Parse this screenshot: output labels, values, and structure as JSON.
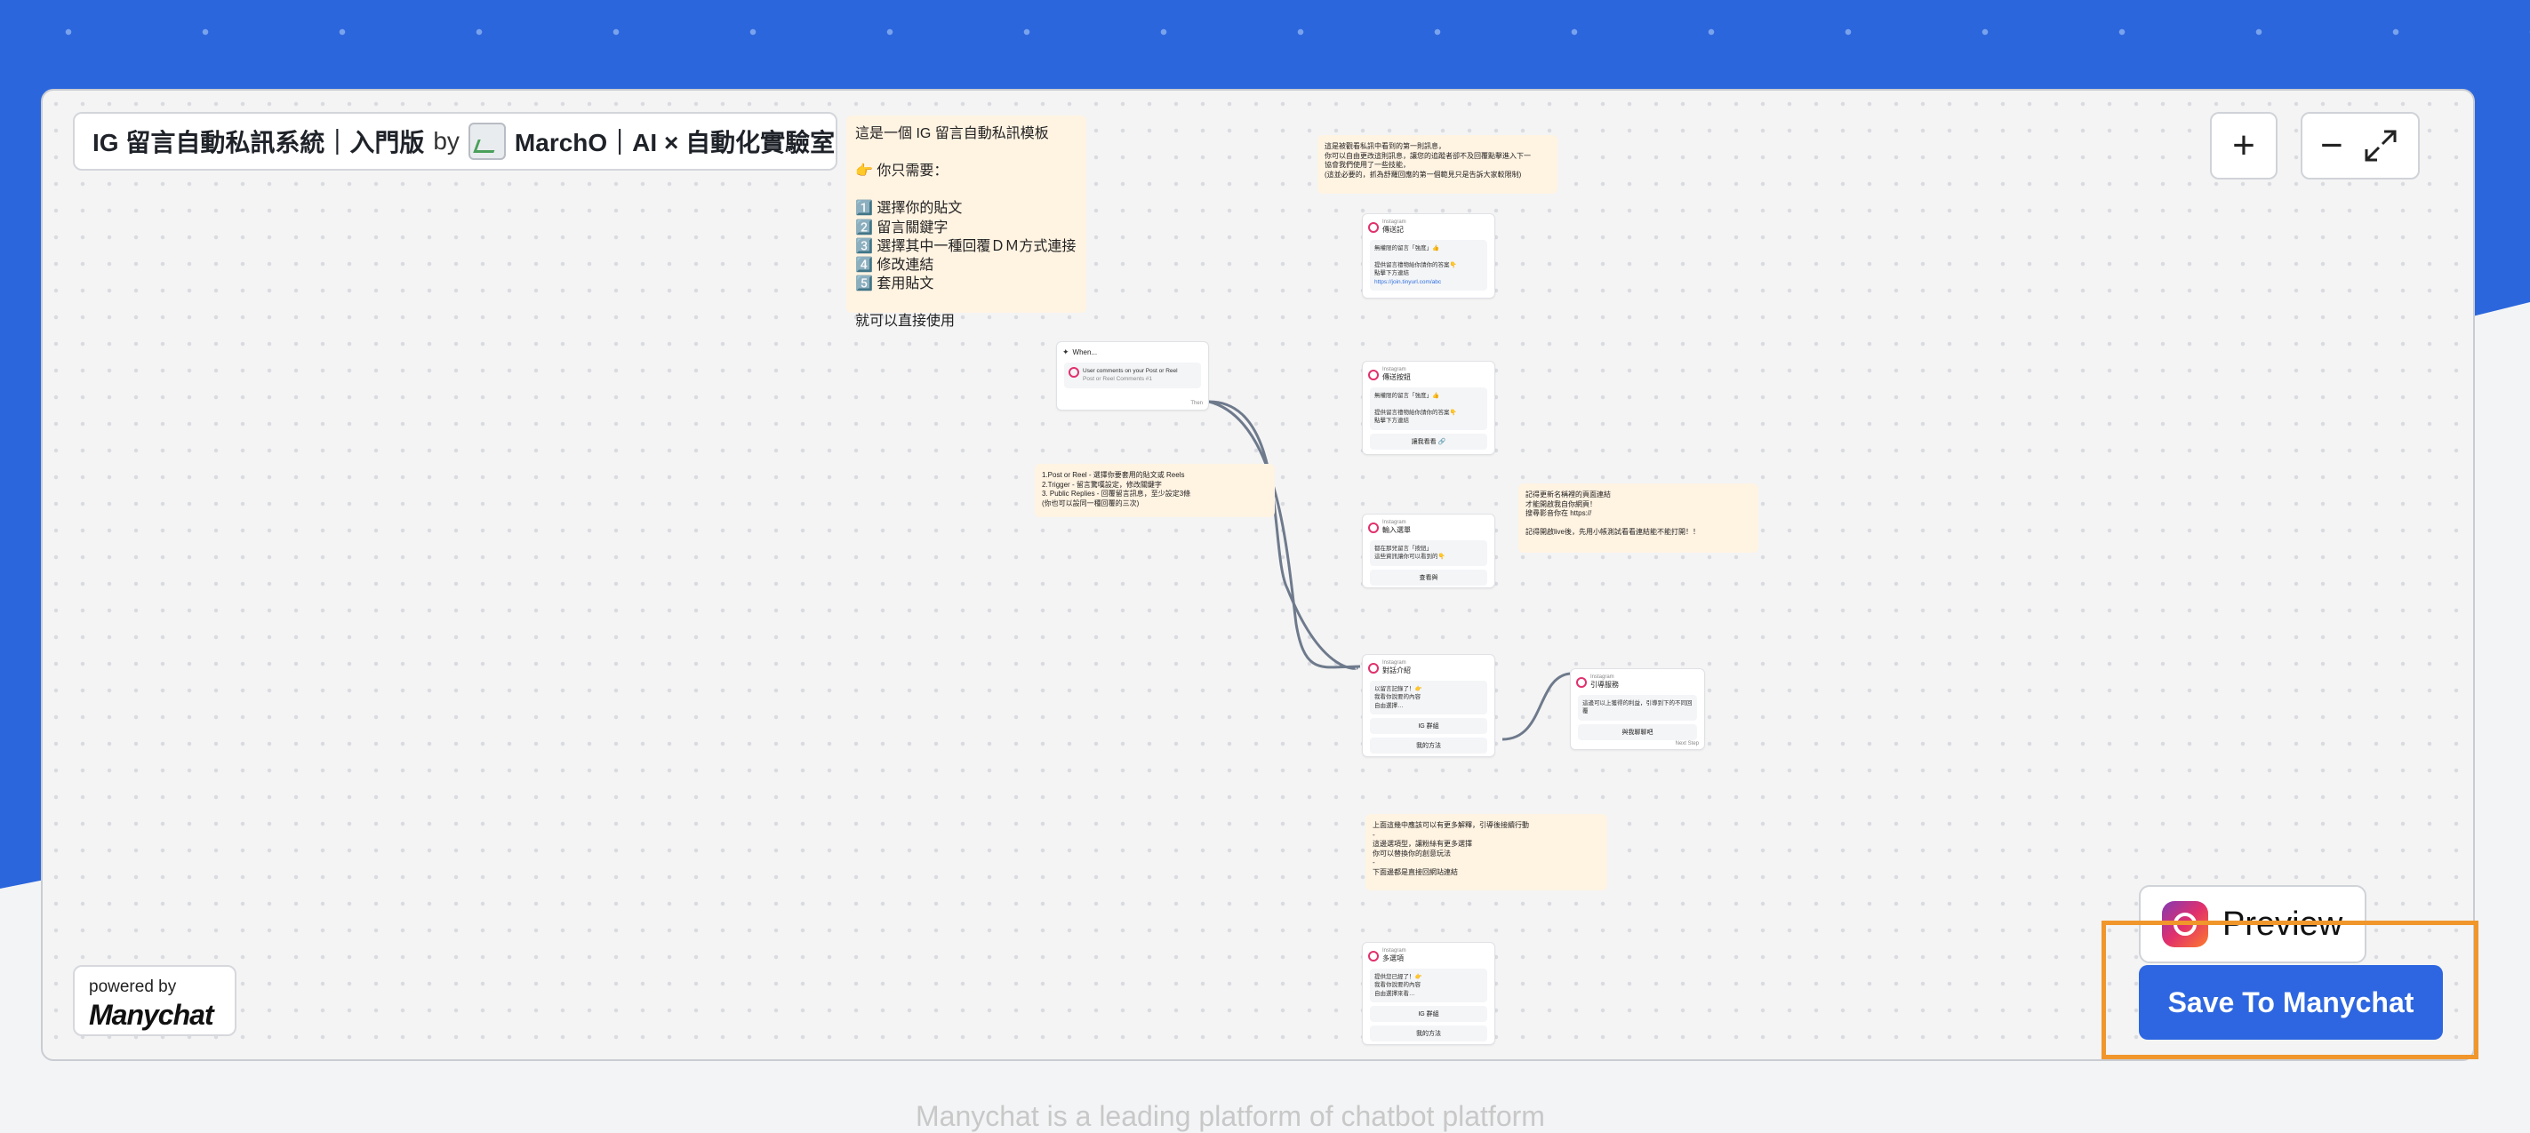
{
  "colors": {
    "brand_blue": "#2b66dc",
    "save_button": "#2d66e0",
    "highlight": "#f0962b",
    "note_bg": "#fff3e2",
    "instagram": "#e1306c"
  },
  "header": {
    "title": "IG 留言自動私訊系統｜入門版",
    "by": "by",
    "author": "MarchO｜AI × 自動化實驗室"
  },
  "controls": {
    "zoom_in": "+",
    "zoom_out": "−",
    "fullscreen_icon": "expand-icon"
  },
  "notes": {
    "intro": "這是一個 IG 留言自動私訊模板\n\n👉 你只需要：\n\n1️⃣ 選擇你的貼文\n2️⃣ 留言關鍵字\n3️⃣ 選擇其中一種回覆ＤＭ方式連接\n4️⃣ 修改連結\n5️⃣ 套用貼文\n\n就可以直接使用",
    "top_center": "這是被觀看私訊中看到的第一則訊息，\n你可以自由更改這則訊息，讓您的追蹤者卻不及回覆點擊進入下一\n協會我們使用了一些技能，\n(這並必要的，抓為舒羅回應的第一個範見只是告訴大家較限制)",
    "left_mid": "1.Post or Reel - 選擇你要套用的貼文或 Reels\n2.Trigger - 留言驚嘆設定，修改關鍵字\n3. Public Replies - 回覆留言訊息，至少設定3條\n(你也可以設同一種回覆的三次)",
    "right_mid": "記得更新名稱裡的頁面連結\n才能開啟我自你網頁！\n搜尋影音你在 https://\n\n記得開啟live後，先用小帳測試看看連結能不能打開！！",
    "bottom": "上面這幾中應該可以有更多解釋，引導後接續行動\n-\n這邊選項型，讓粉絲有更多選擇\n你可以替換你的創意玩法\n-\n下面邊都是直接回網站連結"
  },
  "trigger_card": {
    "label": "When...",
    "event": "User comments on your Post or Reel",
    "sub": "Post or Reel Comments #1",
    "then": "Then"
  },
  "cards": [
    {
      "app": "Instagram",
      "name": "傳送記",
      "msg": "無權限的留言「強度」👍\n\n提供留言禮物給你請你的答案👇\n點擊下方連結",
      "link": "https://join.tinyurl.com/abc",
      "buttons": []
    },
    {
      "app": "Instagram",
      "name": "傳送按鈕",
      "msg": "無權限的留言「強度」👍\n\n提供留言禮物給你請你的答案👇\n點擊下方連結",
      "link": "",
      "buttons": [
        "讓我看看 🔗"
      ]
    },
    {
      "app": "Instagram",
      "name": "輸入選單",
      "msg": "都在那兒留言「按鈕」\n這些資訊讓你可以看到的👇",
      "link": "",
      "buttons": [
        "查看與"
      ]
    },
    {
      "app": "Instagram",
      "name": "對話介紹",
      "msg": "以留言記錄了！👉\n我看你說要的內容\n自由選擇…",
      "link": "",
      "buttons": [
        "IG 群組",
        "我的方法"
      ]
    },
    {
      "app": "Instagram",
      "name": "引導服務",
      "msg": "這邊可以上獲得的利益，引導到下的不同回覆",
      "link": "",
      "buttons": [
        "與我聊聊吧"
      ]
    },
    {
      "app": "Instagram",
      "name": "多選項",
      "msg": "提供您已經了！👉\n我看你說要的內容\n自由選擇來看…",
      "link": "",
      "buttons": [
        "IG 群組",
        "我的方法"
      ]
    }
  ],
  "card_footer": "Next Step",
  "powered_by": {
    "label": "powered by",
    "brand": "Manychat"
  },
  "buttons": {
    "preview": "Preview",
    "save": "Save To Manychat"
  },
  "footer": {
    "text": "Manychat is a leading platform of chatbot platform"
  }
}
